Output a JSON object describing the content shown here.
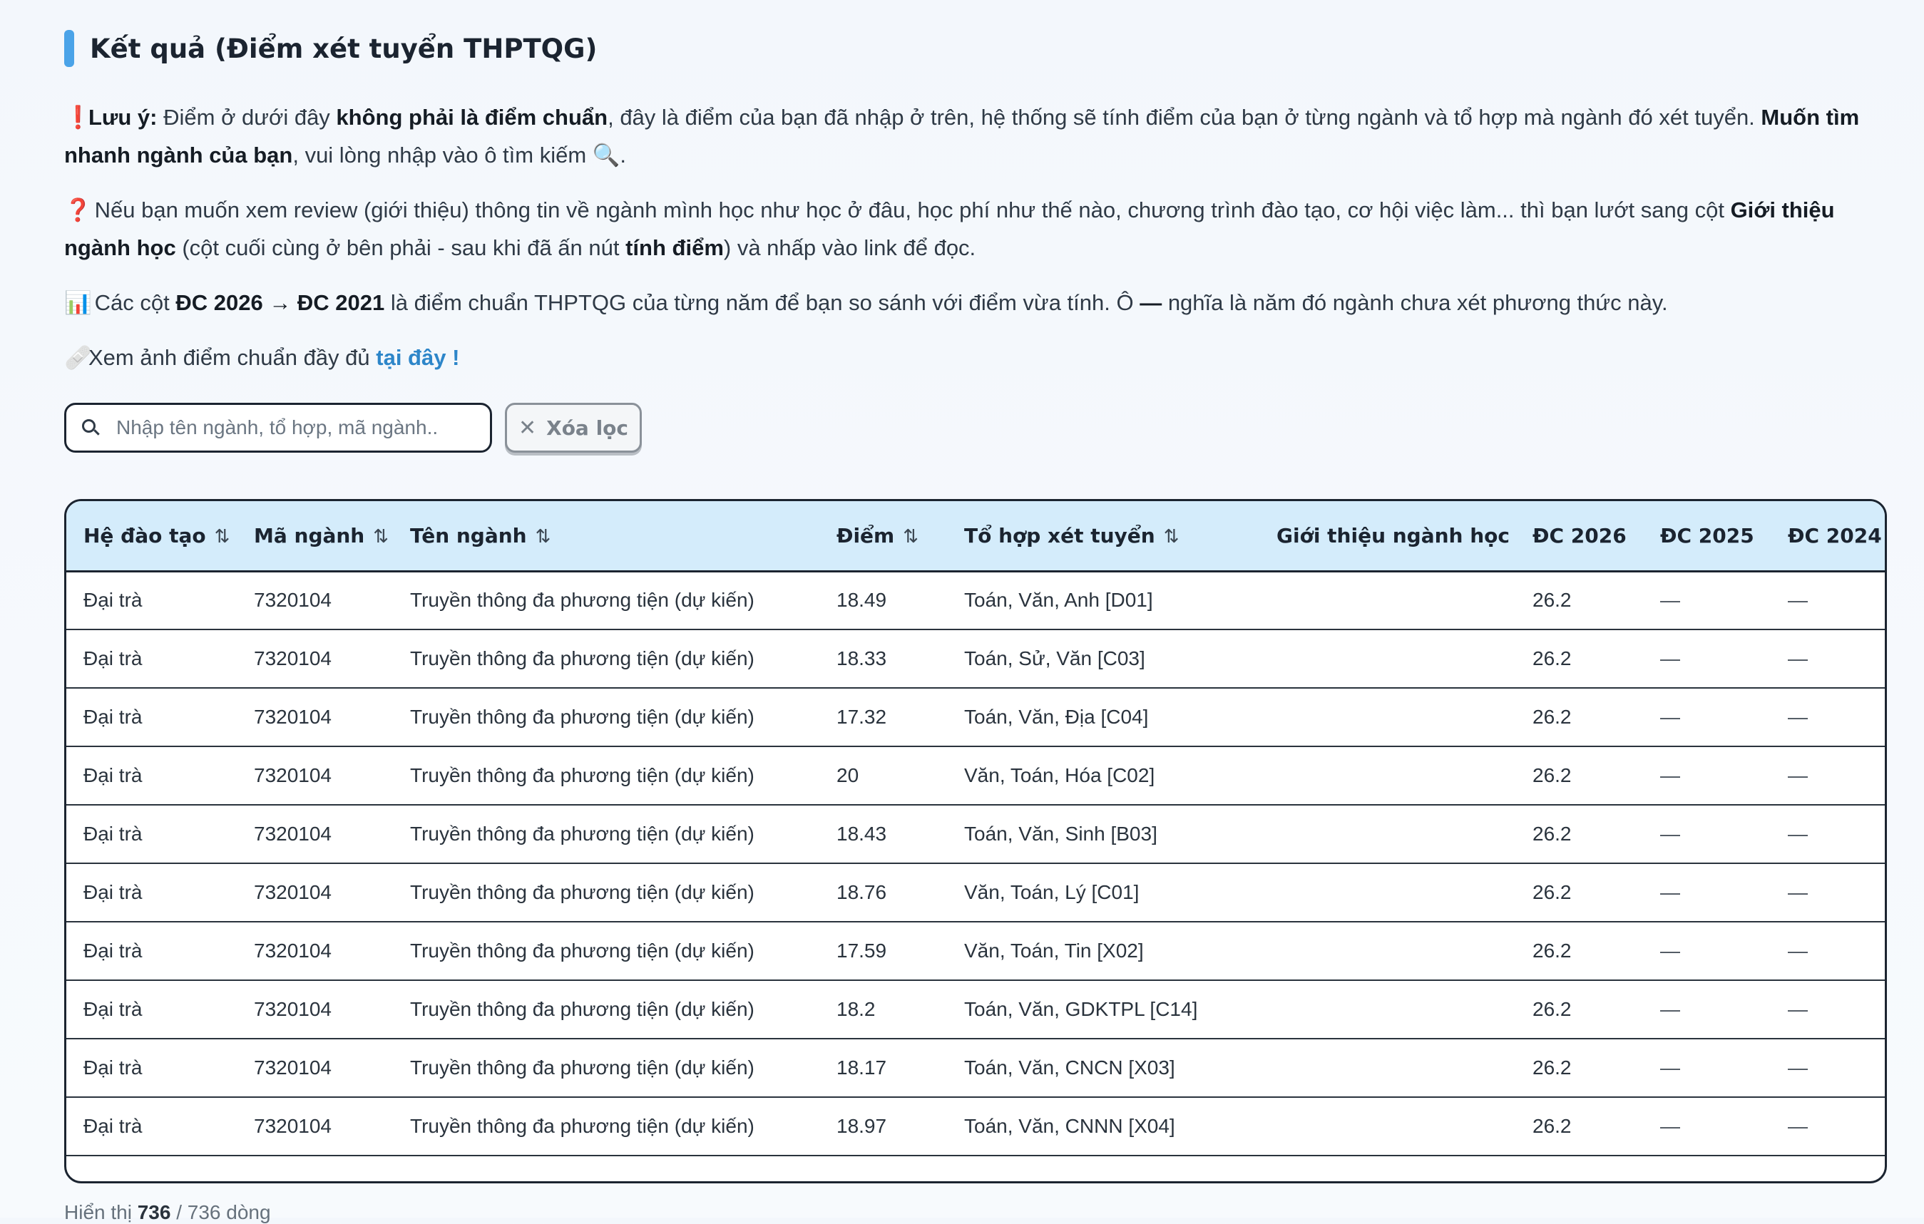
{
  "title": "Kết quả (Điểm xét tuyển THPTQG)",
  "notes": {
    "n1": {
      "icon": "❗",
      "label": "Lưu ý:",
      "t1": " Điểm ở dưới đây ",
      "b1": "không phải là điểm chuẩn",
      "t2": ", đây là điểm của bạn đã nhập ở trên, hệ thống sẽ tính điểm của bạn ở từng ngành và tổ hợp mà ngành đó xét tuyển. ",
      "b2": "Muốn tìm nhanh ngành của bạn",
      "t3": ", vui lòng nhập vào ô tìm kiếm 🔍."
    },
    "n2": {
      "icon": "❓",
      "t1": " Nếu bạn muốn xem review (giới thiệu) thông tin về ngành mình học như học ở đâu, học phí như thế nào, chương trình đào tạo, cơ hội việc làm... thì bạn lướt sang cột ",
      "b1": "Giới thiệu ngành học",
      "t2": " (cột cuối cùng ở bên phải - sau khi đã ấn nút ",
      "b2": "tính điểm",
      "t3": ") và nhấp vào link để đọc."
    },
    "n3": {
      "icon": "📊",
      "t1": " Các cột ",
      "b1": "ĐC 2026 → ĐC 2021",
      "t2": " là điểm chuẩn THPTQG của từng năm để bạn so sánh với điểm vừa tính. Ô ",
      "b2": "—",
      "t3": " nghĩa là năm đó ngành chưa xét phương thức này."
    },
    "n4": {
      "icon": "🩹",
      "t1": "Xem ảnh điểm chuẩn đầy đủ ",
      "link": "tại đây !"
    }
  },
  "search": {
    "placeholder": "Nhập tên ngành, tổ hợp, mã ngành..",
    "value": ""
  },
  "clear_button": {
    "icon": "✕",
    "label": "Xóa lọc"
  },
  "sort_icon": "⇅",
  "table": {
    "headers": {
      "he": "Hệ đào tạo",
      "ma": "Mã ngành",
      "ten": "Tên ngành",
      "diem": "Điểm",
      "tohop": "Tổ hợp xét tuyển",
      "gioithieu": "Giới thiệu ngành học",
      "dc2026": "ĐC 2026",
      "dc2025": "ĐC 2025",
      "dc2024": "ĐC 2024"
    },
    "rows": [
      {
        "he": "Đại trà",
        "ma": "7320104",
        "ten": "Truyền thông đa phương tiện (dự kiến)",
        "diem": "18.49",
        "tohop": "Toán, Văn, Anh [D01]",
        "gioithieu": "",
        "dc2026": "26.2",
        "dc2025": "—",
        "dc2024": "—"
      },
      {
        "he": "Đại trà",
        "ma": "7320104",
        "ten": "Truyền thông đa phương tiện (dự kiến)",
        "diem": "18.33",
        "tohop": "Toán, Sử, Văn [C03]",
        "gioithieu": "",
        "dc2026": "26.2",
        "dc2025": "—",
        "dc2024": "—"
      },
      {
        "he": "Đại trà",
        "ma": "7320104",
        "ten": "Truyền thông đa phương tiện (dự kiến)",
        "diem": "17.32",
        "tohop": "Toán, Văn, Địa [C04]",
        "gioithieu": "",
        "dc2026": "26.2",
        "dc2025": "—",
        "dc2024": "—"
      },
      {
        "he": "Đại trà",
        "ma": "7320104",
        "ten": "Truyền thông đa phương tiện (dự kiến)",
        "diem": "20",
        "tohop": "Văn, Toán, Hóa [C02]",
        "gioithieu": "",
        "dc2026": "26.2",
        "dc2025": "—",
        "dc2024": "—"
      },
      {
        "he": "Đại trà",
        "ma": "7320104",
        "ten": "Truyền thông đa phương tiện (dự kiến)",
        "diem": "18.43",
        "tohop": "Toán, Văn, Sinh [B03]",
        "gioithieu": "",
        "dc2026": "26.2",
        "dc2025": "—",
        "dc2024": "—"
      },
      {
        "he": "Đại trà",
        "ma": "7320104",
        "ten": "Truyền thông đa phương tiện (dự kiến)",
        "diem": "18.76",
        "tohop": "Văn, Toán, Lý [C01]",
        "gioithieu": "",
        "dc2026": "26.2",
        "dc2025": "—",
        "dc2024": "—"
      },
      {
        "he": "Đại trà",
        "ma": "7320104",
        "ten": "Truyền thông đa phương tiện (dự kiến)",
        "diem": "17.59",
        "tohop": "Văn, Toán, Tin [X02]",
        "gioithieu": "",
        "dc2026": "26.2",
        "dc2025": "—",
        "dc2024": "—"
      },
      {
        "he": "Đại trà",
        "ma": "7320104",
        "ten": "Truyền thông đa phương tiện (dự kiến)",
        "diem": "18.2",
        "tohop": "Toán, Văn, GDKTPL [C14]",
        "gioithieu": "",
        "dc2026": "26.2",
        "dc2025": "—",
        "dc2024": "—"
      },
      {
        "he": "Đại trà",
        "ma": "7320104",
        "ten": "Truyền thông đa phương tiện (dự kiến)",
        "diem": "18.17",
        "tohop": "Toán, Văn, CNCN [X03]",
        "gioithieu": "",
        "dc2026": "26.2",
        "dc2025": "—",
        "dc2024": "—"
      },
      {
        "he": "Đại trà",
        "ma": "7320104",
        "ten": "Truyền thông đa phương tiện (dự kiến)",
        "diem": "18.97",
        "tohop": "Toán, Văn, CNNN [X04]",
        "gioithieu": "",
        "dc2026": "26.2",
        "dc2025": "—",
        "dc2024": "—"
      }
    ]
  },
  "footer": {
    "prefix": "Hiển thị ",
    "shown": "736",
    "suffix": " / 736 dòng"
  }
}
